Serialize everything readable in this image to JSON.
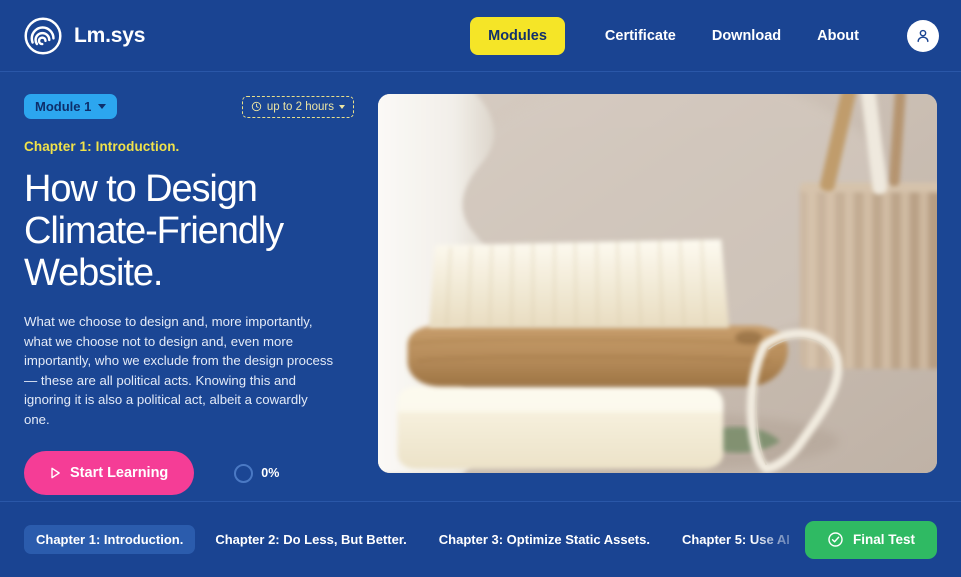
{
  "header": {
    "brand_name": "Lm.sys",
    "logo_icon": "spiral-logo-icon",
    "nav": [
      {
        "label": "Modules",
        "active": true
      },
      {
        "label": "Certificate",
        "active": false
      },
      {
        "label": "Download",
        "active": false
      },
      {
        "label": "About",
        "active": false
      }
    ],
    "avatar_icon": "user-avatar-icon"
  },
  "hero": {
    "module_badge": "Module 1",
    "duration_badge": "up to 2 hours",
    "clock_icon": "clock-icon",
    "chapter_eyebrow": "Chapter 1: Introduction.",
    "headline": "How to Design Climate-Friendly Website.",
    "body": "What we choose to design and, more importantly, what we choose not to design and, even more importantly, who we exclude from the design process — these are all political acts. Knowing this and ignoring it is also a political act, albeit a cowardly one.",
    "start_button": "Start Learning",
    "play_icon": "play-icon",
    "progress_value": "0%",
    "image_alt": "wooden-nail-brush-on-soap-bar-with-bamboo-toothbrushes"
  },
  "chapter_bar": {
    "chapters": [
      {
        "label": "Chapter 1: Introduction.",
        "active": true,
        "faded": false
      },
      {
        "label": "Chapter 2: Do Less, But Better.",
        "active": false,
        "faded": false
      },
      {
        "label": "Chapter 3: Optimize Static Assets.",
        "active": false,
        "faded": false
      },
      {
        "label": "Chapter 5: Use AI",
        "active": false,
        "faded": true
      }
    ],
    "final_test_label": "Final Test",
    "final_test_icon": "check-circle-icon"
  },
  "colors": {
    "background": "#1b4694",
    "header": "#1a4492",
    "accent_yellow": "#f5e527",
    "accent_pink": "#f53d96",
    "accent_green": "#2fba63",
    "accent_blue": "#2ca6ef",
    "eyebrow_yellow": "#f0e24a"
  }
}
